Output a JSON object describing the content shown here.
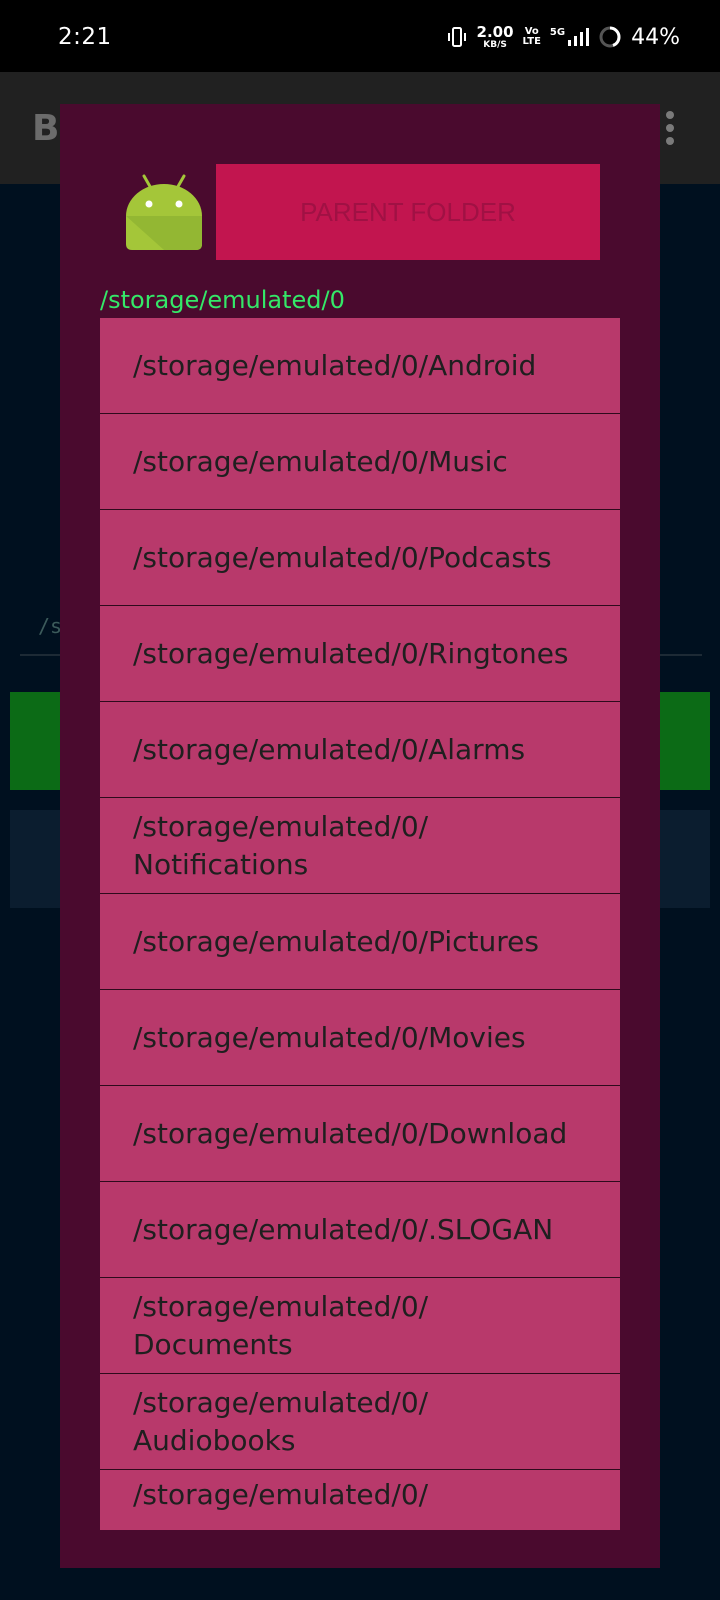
{
  "status_bar": {
    "time": "2:21",
    "net_speed_value": "2.00",
    "net_speed_unit": "KB/S",
    "volte_top": "Vo",
    "volte_bottom": "LTE",
    "network": "5G",
    "battery_percent": "44%"
  },
  "app_bar": {
    "title": "B"
  },
  "background": {
    "path_text": "/s"
  },
  "dialog": {
    "parent_button_label": "PARENT FOLDER",
    "current_path": "/storage/emulated/0",
    "folders": [
      "/storage/emulated/0/Android",
      "/storage/emulated/0/Music",
      "/storage/emulated/0/Podcasts",
      "/storage/emulated/0/Ringtones",
      "/storage/emulated/0/Alarms",
      "/storage/emulated/0/\nNotifications",
      "/storage/emulated/0/Pictures",
      "/storage/emulated/0/Movies",
      "/storage/emulated/0/Download",
      "/storage/emulated/0/.SLOGAN",
      "/storage/emulated/0/\nDocuments",
      "/storage/emulated/0/\nAudiobooks",
      "/storage/emulated/0/"
    ]
  },
  "colors": {
    "dialog_bg": "#4a0a2e",
    "button_bg": "#c2154f",
    "item_bg": "#b8396b",
    "path_green": "#34e868",
    "android_green": "#a4c639"
  }
}
